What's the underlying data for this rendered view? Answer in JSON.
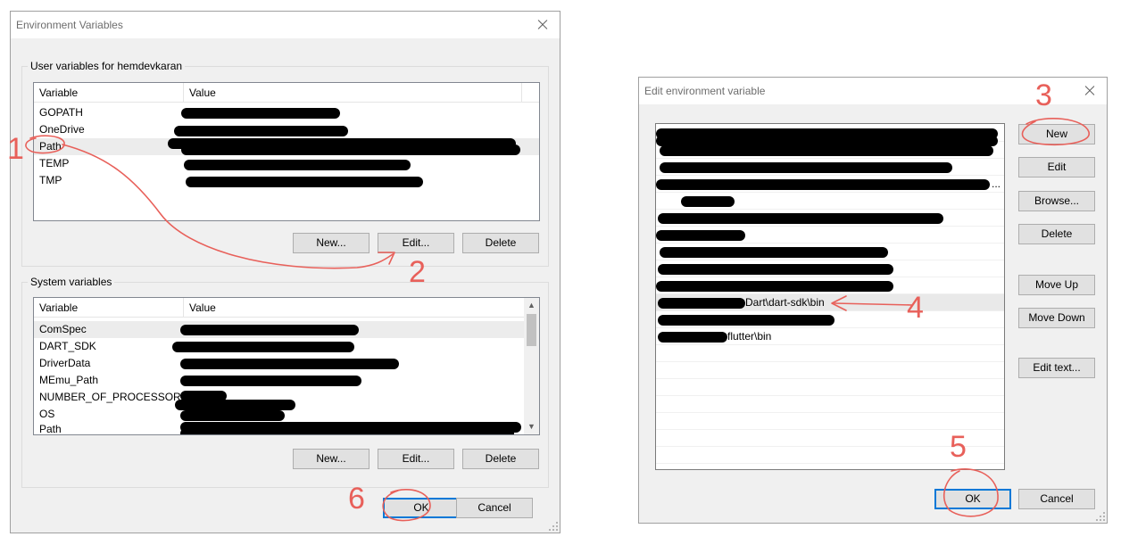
{
  "env_dialog": {
    "title": "Environment Variables",
    "user_group": {
      "title": "User variables for hemdevkaran",
      "columns": [
        "Variable",
        "Value"
      ],
      "rows": [
        {
          "name": "GOPATH",
          "value_redacted": true
        },
        {
          "name": "OneDrive",
          "value_redacted": true
        },
        {
          "name": "Path",
          "value_redacted": true,
          "selected": true
        },
        {
          "name": "TEMP",
          "value_redacted": true
        },
        {
          "name": "TMP",
          "value_redacted": true
        }
      ],
      "buttons": {
        "new": "New...",
        "edit": "Edit...",
        "delete": "Delete"
      }
    },
    "system_group": {
      "title": "System variables",
      "columns": [
        "Variable",
        "Value"
      ],
      "rows": [
        {
          "name": "ComSpec",
          "value_redacted": true,
          "selected": true
        },
        {
          "name": "DART_SDK",
          "value_redacted": true
        },
        {
          "name": "DriverData",
          "value_redacted": true
        },
        {
          "name": "MEmu_Path",
          "value_redacted": true
        },
        {
          "name": "NUMBER_OF_PROCESSORS",
          "value_redacted": true
        },
        {
          "name": "OS",
          "value_redacted": true
        },
        {
          "name": "Path",
          "value_redacted": true
        }
      ],
      "buttons": {
        "new": "New...",
        "edit": "Edit...",
        "delete": "Delete"
      }
    },
    "ok": "OK",
    "cancel": "Cancel"
  },
  "edit_dialog": {
    "title": "Edit environment variable",
    "entries": [
      {
        "text": "",
        "redacted": true
      },
      {
        "text": "",
        "redacted": true
      },
      {
        "text": "",
        "redacted": true
      },
      {
        "text": "...",
        "redacted": true
      },
      {
        "text": "",
        "redacted": true
      },
      {
        "text": "",
        "redacted": true
      },
      {
        "text": "",
        "redacted": true
      },
      {
        "text": "",
        "redacted": true
      },
      {
        "text": "",
        "redacted": true
      },
      {
        "text": "",
        "redacted": true
      },
      {
        "text": "Dart\\dart-sdk\\bin",
        "redacted": true,
        "selected": true
      },
      {
        "text": "",
        "redacted": true
      },
      {
        "text": "flutter\\bin",
        "redacted": true
      }
    ],
    "buttons": {
      "new": "New",
      "edit": "Edit",
      "browse": "Browse...",
      "delete": "Delete",
      "move_up": "Move Up",
      "move_down": "Move Down",
      "edit_text": "Edit text..."
    },
    "ok": "OK",
    "cancel": "Cancel"
  },
  "annotations": {
    "color": "#e8605a",
    "numbers": [
      "1",
      "2",
      "3",
      "4",
      "5",
      "6"
    ]
  }
}
